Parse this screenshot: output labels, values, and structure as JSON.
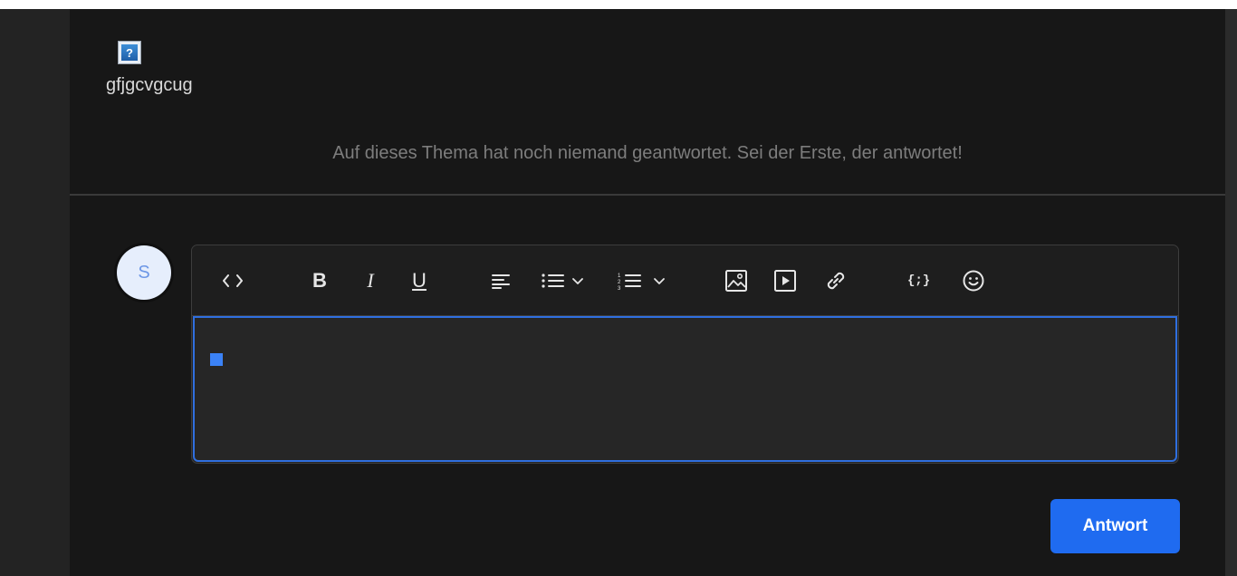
{
  "post": {
    "image_icon": "broken-image-icon",
    "image_glyph": "?",
    "text": "gfjgcvgcug"
  },
  "empty_state": "Auf dieses Thema hat noch niemand geantwortet. Sei der Erste, der antwortet!",
  "avatar": {
    "initial": "S"
  },
  "toolbar": {
    "items": [
      {
        "name": "code-view-icon"
      },
      {
        "name": "bold-icon",
        "label": "B"
      },
      {
        "name": "italic-icon",
        "label": "I"
      },
      {
        "name": "underline-icon",
        "label": "U"
      },
      {
        "name": "align-left-icon"
      },
      {
        "name": "bullet-list-icon"
      },
      {
        "name": "numbered-list-icon"
      },
      {
        "name": "image-icon"
      },
      {
        "name": "video-icon"
      },
      {
        "name": "link-icon"
      },
      {
        "name": "code-block-icon",
        "label": "{;}"
      },
      {
        "name": "emoji-icon"
      }
    ]
  },
  "editor": {
    "value": ""
  },
  "submit_label": "Antwort",
  "colors": {
    "accent": "#1f6bf0",
    "editor_focus_border": "#2f6fe0",
    "background": "#171717"
  }
}
